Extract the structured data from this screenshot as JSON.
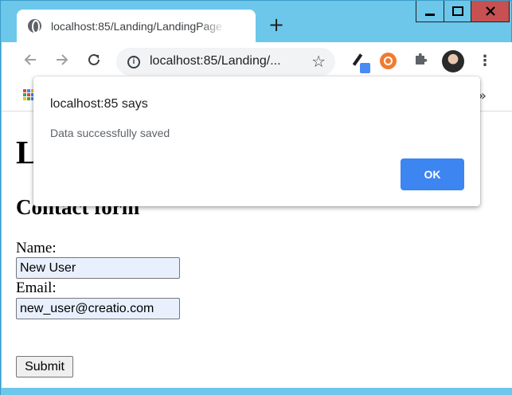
{
  "browser": {
    "tab": {
      "title": "localhost:85/Landing/LandingPage",
      "icon": "globe-icon"
    },
    "new_tab": "+",
    "toolbar": {
      "url": "localhost:85/Landing/...",
      "back_icon": "back-arrow-icon",
      "forward_icon": "forward-arrow-icon",
      "reload_icon": "reload-icon",
      "info_icon": "info-icon",
      "star_icon": "star-icon",
      "extensions": [
        "color-picker-icon",
        "orange-circle-icon",
        "puzzle-icon"
      ],
      "menu_icon": "kebab-menu-icon"
    },
    "bookmarks": {
      "apps_icon": "apps-grid-icon",
      "more": "»"
    },
    "window_controls": [
      "minimize-icon",
      "maximize-icon",
      "close-icon"
    ]
  },
  "page": {
    "heading": "L",
    "subheading": "Contact form",
    "form": {
      "name_label": "Name:",
      "name_value": "New User",
      "email_label": "Email:",
      "email_value": "new_user@creatio.com",
      "submit_label": "Submit"
    }
  },
  "dialog": {
    "title": "localhost:85 says",
    "message": "Data successfully saved",
    "ok_label": "OK"
  },
  "colors": {
    "frame": "#6cc7ea",
    "close_button": "#c75050",
    "ok_button": "#3d85f0",
    "input_autofill": "#e8f0fe"
  }
}
